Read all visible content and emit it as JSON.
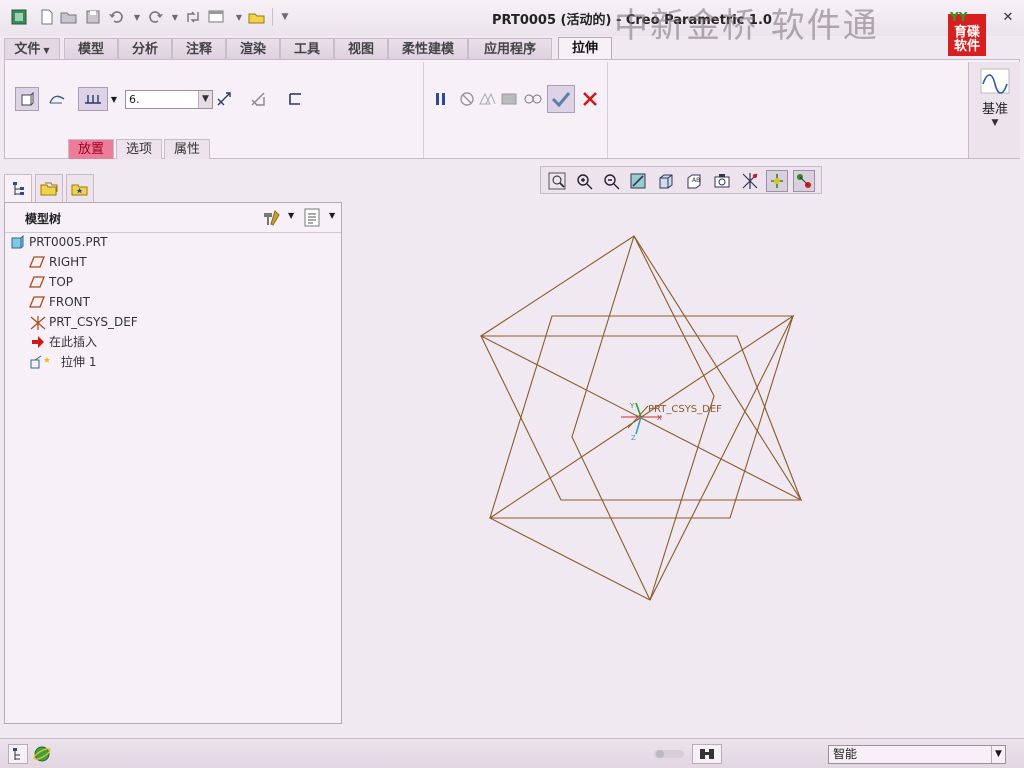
{
  "window": {
    "title": "PRT0005 (活动的) - Creo Parametric 1.0",
    "watermark": "中新金桥  软件通",
    "logo_text": "育碟\n软件",
    "logo_badge": "YY"
  },
  "quick_access": [
    "app-icon",
    "new-icon",
    "open-icon",
    "save-icon",
    "undo-icon",
    "redo-icon",
    "regenerate-icon",
    "windows-icon",
    "close-window-icon",
    "customize-icon"
  ],
  "tabs": [
    {
      "label": "文件",
      "has_caret": true
    },
    {
      "label": "模型"
    },
    {
      "label": "分析"
    },
    {
      "label": "注释"
    },
    {
      "label": "渲染"
    },
    {
      "label": "工具"
    },
    {
      "label": "视图"
    },
    {
      "label": "柔性建模"
    },
    {
      "label": "应用程序"
    },
    {
      "label": "拉伸",
      "active": true
    }
  ],
  "ribbon": {
    "depth_value": "6.",
    "subtabs": [
      {
        "label": "放置",
        "highlight": true
      },
      {
        "label": "选项"
      },
      {
        "label": "属性"
      }
    ],
    "datum_label": "基准"
  },
  "tree": {
    "title": "模型树",
    "items": [
      {
        "label": "PRT0005.PRT",
        "icon": "part-icon",
        "indent": 0
      },
      {
        "label": "RIGHT",
        "icon": "datum-plane-icon",
        "indent": 1
      },
      {
        "label": "TOP",
        "icon": "datum-plane-icon",
        "indent": 1
      },
      {
        "label": "FRONT",
        "icon": "datum-plane-icon",
        "indent": 1
      },
      {
        "label": "PRT_CSYS_DEF",
        "icon": "csys-icon",
        "indent": 1
      },
      {
        "label": "在此插入",
        "icon": "insert-here-arrow-icon",
        "indent": 1
      },
      {
        "label": "拉伸 1",
        "icon": "extrude-feature-icon",
        "indent": 1
      }
    ]
  },
  "canvas": {
    "csys_label": "PRT_CSYS_DEF",
    "axis_x": "X",
    "axis_y": "Y",
    "axis_z": "Z",
    "sketch_color": "#8b5a2b"
  },
  "statusbar": {
    "filter_value": "智能"
  },
  "colors": {
    "background": "#f1e9f1",
    "highlight_tab": "#ec7d98",
    "confirm_check": "#5b7fa8",
    "cancel_x": "#d01818",
    "pause": "#2a4a9a"
  }
}
